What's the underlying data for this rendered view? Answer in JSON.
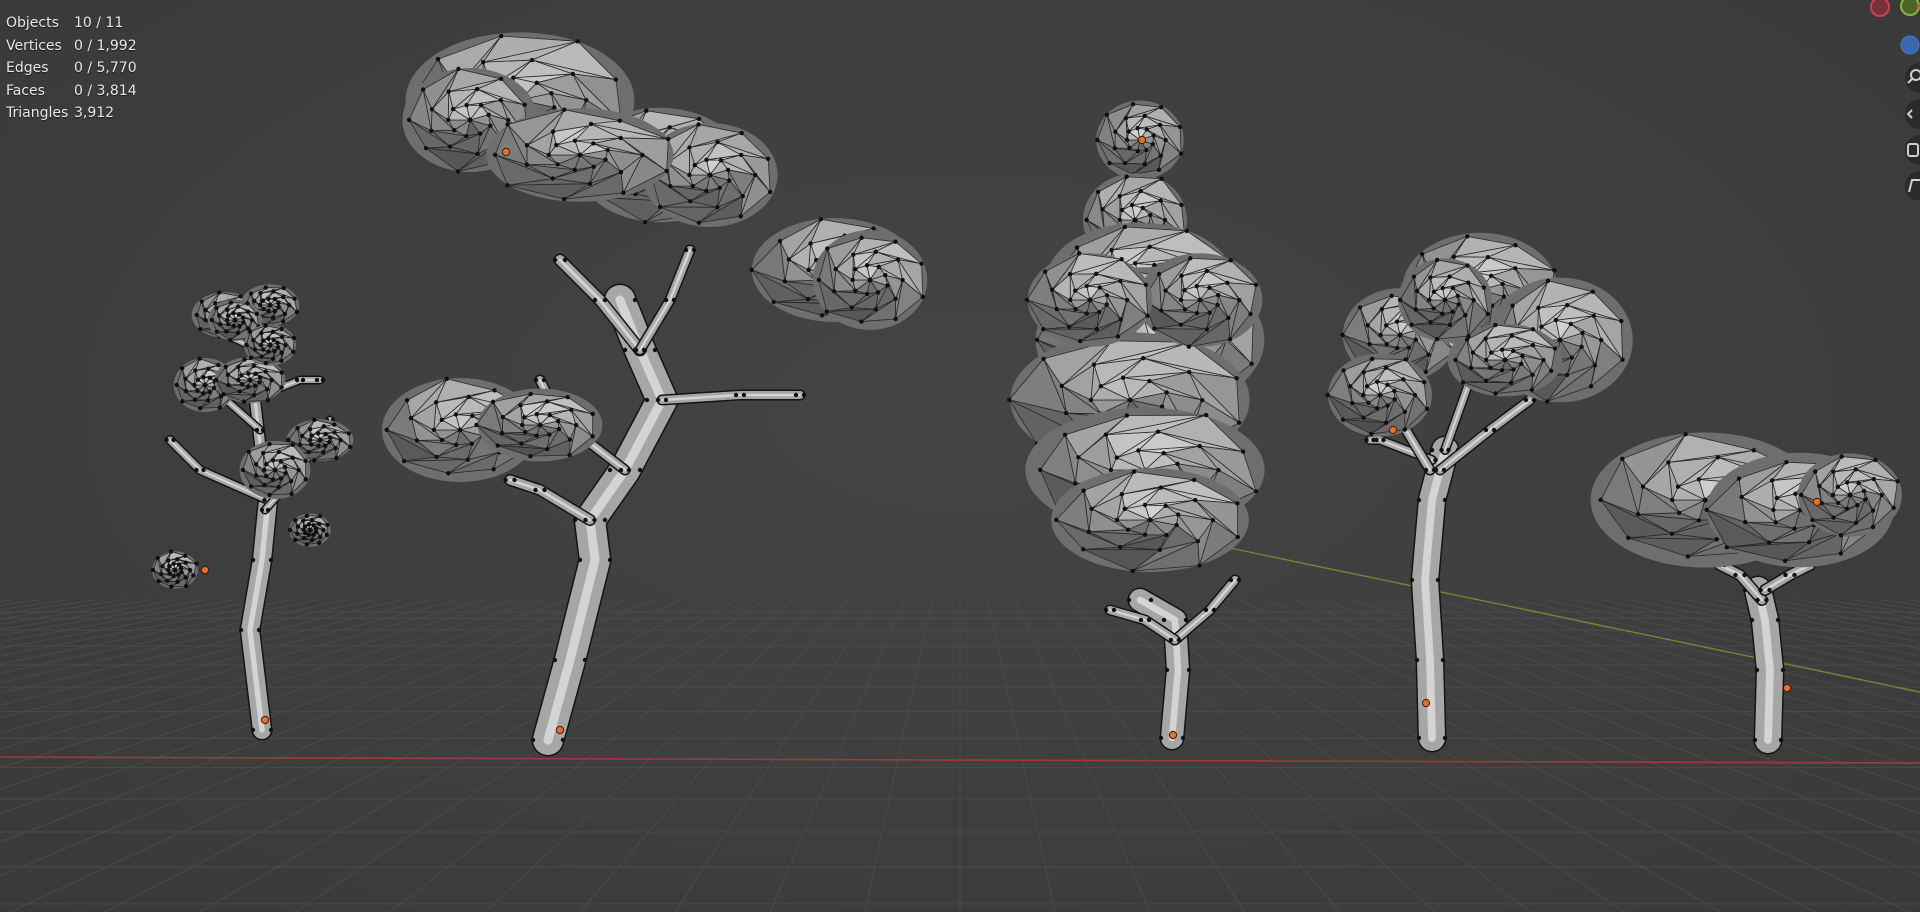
{
  "stats": {
    "objects": {
      "label": "Objects",
      "value": "10 / 11"
    },
    "vertices": {
      "label": "Vertices",
      "value": "0 / 1,992"
    },
    "edges": {
      "label": "Edges",
      "value": "0 / 5,770"
    },
    "faces": {
      "label": "Faces",
      "value": "0 / 3,814"
    },
    "triangles": {
      "label": "Triangles",
      "value": "3,912"
    }
  },
  "scene": {
    "tree_count": 5,
    "colors": {
      "background": "#3f3f3f",
      "grid": "#4a4a4a",
      "x_axis": "#9b3a3e",
      "y_axis": "#6a8a34",
      "mesh": "#b4b4b4",
      "vertex": "#101010",
      "origin": "#e8702a"
    }
  },
  "gizmo": {
    "axes": [
      {
        "name": "x-axis-handle",
        "color": "#c9434f"
      },
      {
        "name": "y-axis-handle",
        "color": "#86b34a"
      },
      {
        "name": "z-axis-handle",
        "color": "#4978c5"
      }
    ],
    "icons": [
      "zoom-icon",
      "hand-pan-icon",
      "camera-icon",
      "perspective-icon"
    ]
  }
}
